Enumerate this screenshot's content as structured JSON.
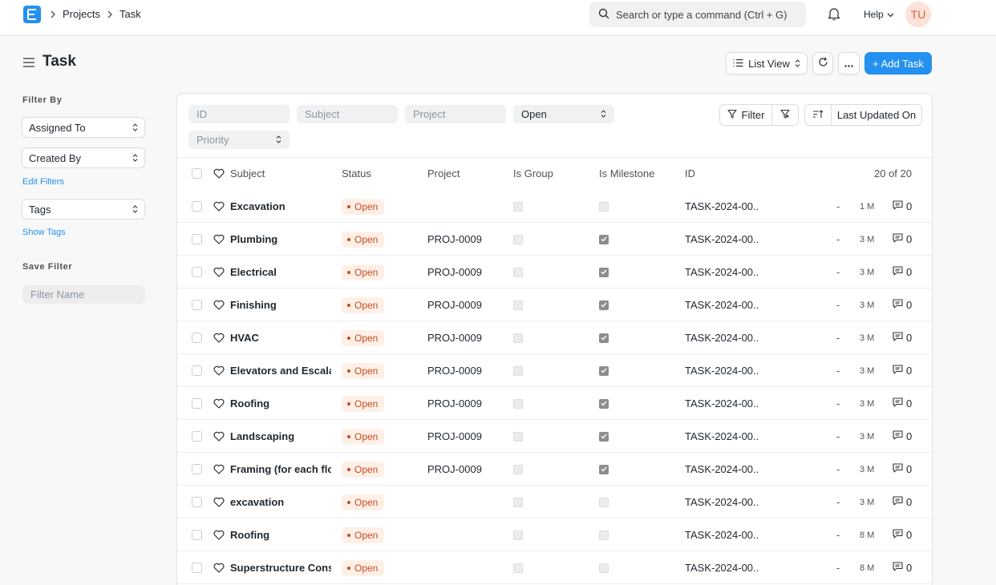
{
  "navbar": {
    "breadcrumbs": [
      "Projects",
      "Task"
    ],
    "search_placeholder": "Search or type a command (Ctrl + G)",
    "help_label": "Help",
    "avatar_initials": "TU"
  },
  "page": {
    "title": "Task",
    "list_view_label": "List View",
    "add_button_label": "+ Add Task"
  },
  "sidebar": {
    "filter_by_label": "Filter By",
    "assigned_to": "Assigned To",
    "created_by": "Created By",
    "edit_filters": "Edit Filters",
    "tags": "Tags",
    "show_tags": "Show Tags",
    "save_filter_label": "Save Filter",
    "filter_name_placeholder": "Filter Name"
  },
  "filters": {
    "id_placeholder": "ID",
    "subject_placeholder": "Subject",
    "project_placeholder": "Project",
    "status_value": "Open",
    "priority_value": "Priority",
    "filter_button": "Filter",
    "sort_label": "Last Updated On"
  },
  "table": {
    "columns": {
      "subject": "Subject",
      "status": "Status",
      "project": "Project",
      "is_group": "Is Group",
      "is_milestone": "Is Milestone",
      "id": "ID"
    },
    "count": "20 of 20",
    "rows": [
      {
        "subject": "Excavation",
        "status": "Open",
        "project": "",
        "is_group": false,
        "is_milestone": false,
        "id": "TASK-2024-00...",
        "dash": "-",
        "age": "1 M",
        "comments": "0"
      },
      {
        "subject": "Plumbing",
        "status": "Open",
        "project": "PROJ-0009",
        "is_group": false,
        "is_milestone": true,
        "id": "TASK-2024-00...",
        "dash": "-",
        "age": "3 M",
        "comments": "0"
      },
      {
        "subject": "Electrical",
        "status": "Open",
        "project": "PROJ-0009",
        "is_group": false,
        "is_milestone": true,
        "id": "TASK-2024-00...",
        "dash": "-",
        "age": "3 M",
        "comments": "0"
      },
      {
        "subject": "Finishing",
        "status": "Open",
        "project": "PROJ-0009",
        "is_group": false,
        "is_milestone": true,
        "id": "TASK-2024-00...",
        "dash": "-",
        "age": "3 M",
        "comments": "0"
      },
      {
        "subject": "HVAC",
        "status": "Open",
        "project": "PROJ-0009",
        "is_group": false,
        "is_milestone": true,
        "id": "TASK-2024-00...",
        "dash": "-",
        "age": "3 M",
        "comments": "0"
      },
      {
        "subject": "Elevators and Escalato",
        "status": "Open",
        "project": "PROJ-0009",
        "is_group": false,
        "is_milestone": true,
        "id": "TASK-2024-00...",
        "dash": "-",
        "age": "3 M",
        "comments": "0"
      },
      {
        "subject": "Roofing",
        "status": "Open",
        "project": "PROJ-0009",
        "is_group": false,
        "is_milestone": true,
        "id": "TASK-2024-00...",
        "dash": "-",
        "age": "3 M",
        "comments": "0"
      },
      {
        "subject": "Landscaping",
        "status": "Open",
        "project": "PROJ-0009",
        "is_group": false,
        "is_milestone": true,
        "id": "TASK-2024-00...",
        "dash": "-",
        "age": "3 M",
        "comments": "0"
      },
      {
        "subject": "Framing (for each floo",
        "status": "Open",
        "project": "PROJ-0009",
        "is_group": false,
        "is_milestone": true,
        "id": "TASK-2024-00...",
        "dash": "-",
        "age": "3 M",
        "comments": "0"
      },
      {
        "subject": "excavation",
        "status": "Open",
        "project": "",
        "is_group": false,
        "is_milestone": false,
        "id": "TASK-2024-00...",
        "dash": "-",
        "age": "3 M",
        "comments": "0"
      },
      {
        "subject": "Roofing",
        "status": "Open",
        "project": "",
        "is_group": false,
        "is_milestone": false,
        "id": "TASK-2024-00...",
        "dash": "-",
        "age": "8 M",
        "comments": "0"
      },
      {
        "subject": "Superstructure Constr",
        "status": "Open",
        "project": "",
        "is_group": false,
        "is_milestone": false,
        "id": "TASK-2024-00...",
        "dash": "-",
        "age": "8 M",
        "comments": "0"
      }
    ]
  },
  "colors": {
    "primary": "#2490ef",
    "status_open_bg": "#fff0e7",
    "status_open_text": "#c8491e"
  }
}
